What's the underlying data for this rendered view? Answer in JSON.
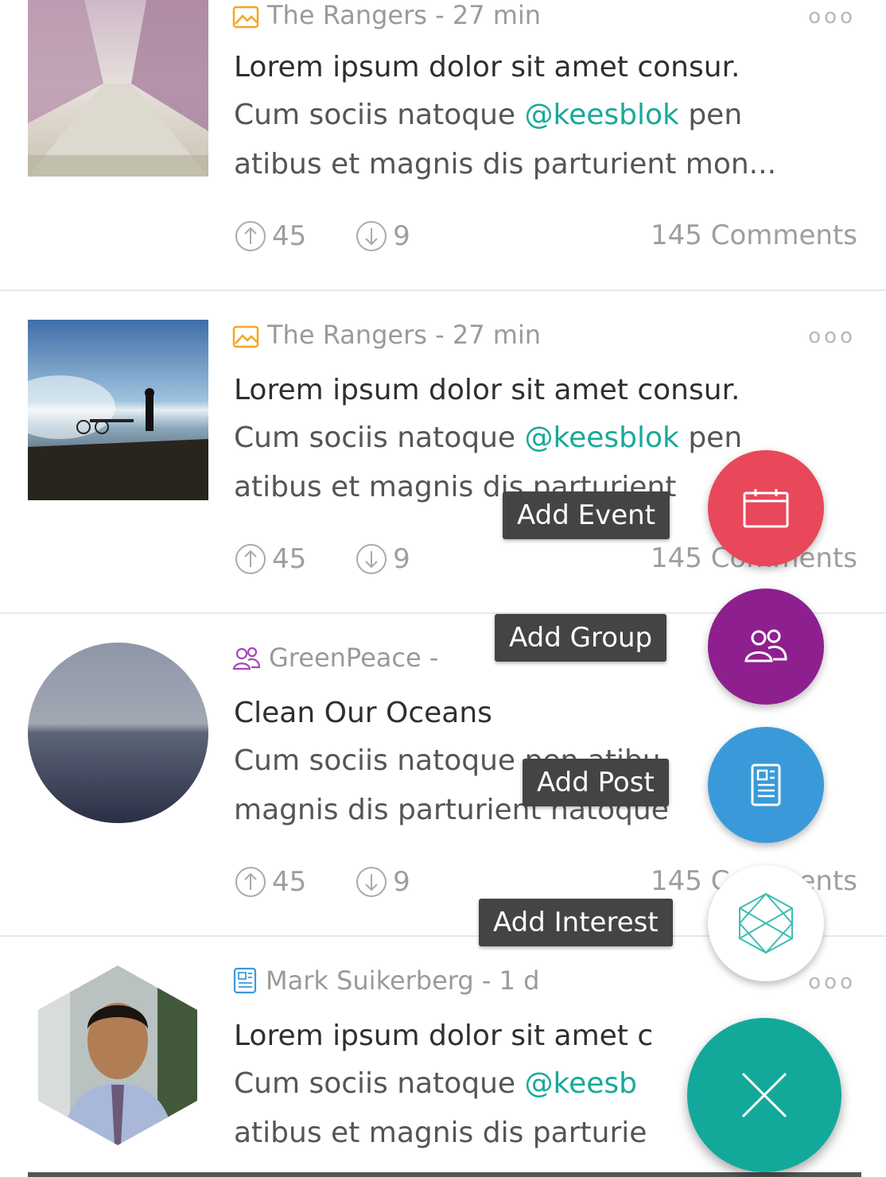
{
  "posts": [
    {
      "source": "The Rangers - 27 min",
      "source_icon": "image-icon",
      "title": "Lorem ipsum dolor sit amet consur.",
      "line1_pre": "Cum sociis natoque ",
      "line1_mention": "@keesblok",
      "line1_post": " pen",
      "line2": "atibus et magnis dis parturient mon...",
      "upvotes": "45",
      "downvotes": "9",
      "comments": "145 Comments",
      "more": "ooo"
    },
    {
      "source": "The Rangers - 27 min",
      "source_icon": "image-icon",
      "title": "Lorem ipsum dolor sit amet consur.",
      "line1_pre": "Cum sociis natoque ",
      "line1_mention": "@keesblok",
      "line1_post": " pen",
      "line2": "atibus et magnis dis parturient",
      "upvotes": "45",
      "downvotes": "9",
      "comments": "145 Comments",
      "more": "ooo"
    },
    {
      "source": "GreenPeace -",
      "source_icon": "group-icon",
      "title": "Clean Our Oceans",
      "line1": "Cum sociis natoque pen atibu",
      "line2": "magnis dis parturient natoque",
      "upvotes": "45",
      "downvotes": "9",
      "comments": "145 Comments",
      "more": "ooo"
    },
    {
      "source": "Mark Suikerberg - 1 d",
      "source_icon": "post-icon",
      "title": "Lorem ipsum dolor sit amet c",
      "line1_pre": "Cum sociis natoque ",
      "line1_mention": "@keesb",
      "line2": "atibus et magnis dis parturie",
      "more": "ooo"
    }
  ],
  "fab_menu": {
    "add_event": "Add Event",
    "add_group": "Add Group",
    "add_post": "Add Post",
    "add_interest": "Add Interest"
  },
  "colors": {
    "event": "#e8485a",
    "group": "#8e1f8e",
    "post": "#3a9ad9",
    "interest": "#ffffff",
    "close": "#13a99a",
    "mention": "#18a99a"
  }
}
